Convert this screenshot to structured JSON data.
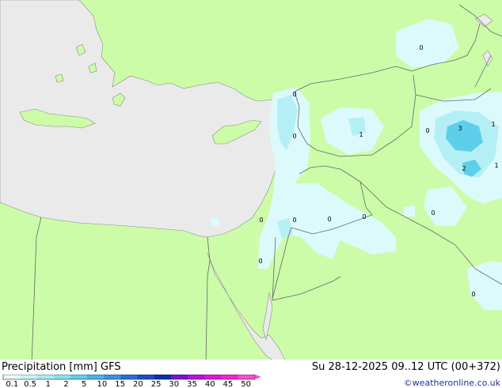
{
  "footer": {
    "title": "Precipitation [mm]  GFS",
    "datetime": "Su 28-12-2025 09..12 UTC (00+372)",
    "credit": "©weatheronline.co.uk"
  },
  "legend": {
    "ticks": [
      "0.1",
      "0.5",
      "1",
      "2",
      "5",
      "10",
      "15",
      "20",
      "25",
      "30",
      "35",
      "40",
      "45",
      "50"
    ],
    "colors": [
      "#e8fbfb",
      "#c8f4f8",
      "#a8ecf4",
      "#88e0ef",
      "#64cdeb",
      "#48b4e4",
      "#3a93dc",
      "#2a6fd2",
      "#1c4fc8",
      "#0c2ea8",
      "#7a12d8",
      "#b414dc",
      "#de18d8",
      "#f028c8",
      "#f850d0"
    ]
  },
  "colors": {
    "land": "#ccfca8",
    "sea": "#eaeaea",
    "border": "#666666",
    "precip_light": "#dcfafc",
    "precip_medium": "#b4eff6",
    "precip_heavy": "#5ecfeb"
  },
  "map_values": [
    {
      "id": "v1",
      "label": "0"
    },
    {
      "id": "v2",
      "label": "0"
    },
    {
      "id": "v3",
      "label": "0"
    },
    {
      "id": "v4",
      "label": "1"
    },
    {
      "id": "v5",
      "label": "0"
    },
    {
      "id": "v6",
      "label": "3"
    },
    {
      "id": "v7",
      "label": "1"
    },
    {
      "id": "v8",
      "label": "2"
    },
    {
      "id": "v9",
      "label": "1"
    },
    {
      "id": "v10",
      "label": "0"
    },
    {
      "id": "v11",
      "label": "0"
    },
    {
      "id": "v12",
      "label": "0"
    },
    {
      "id": "v13",
      "label": "0"
    },
    {
      "id": "v14",
      "label": "0"
    },
    {
      "id": "v15",
      "label": "0"
    },
    {
      "id": "v16",
      "label": "0"
    }
  ]
}
